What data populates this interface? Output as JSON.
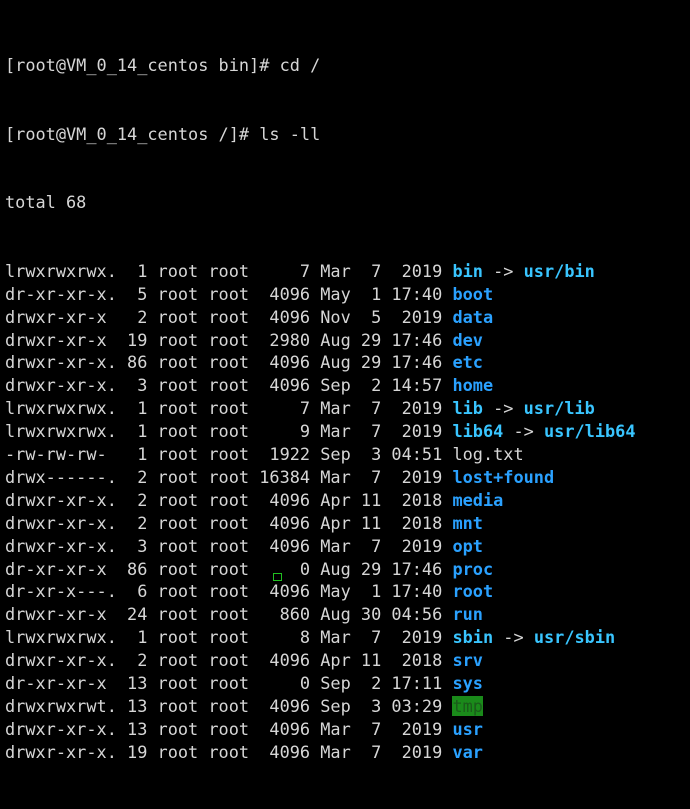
{
  "terminal": {
    "colors": {
      "background": "#000000",
      "text": "#d6d6d6",
      "directory": "#2aa1ff",
      "symlink": "#39c5ff",
      "sticky_dir_bg": "#1a8a1a",
      "cursor": "#20c020"
    },
    "prompts": [
      {
        "text": "[root@VM_0_14_centos bin]# cd /"
      },
      {
        "text": "[root@VM_0_14_centos /]# ls -ll"
      }
    ],
    "total": "total 68",
    "entries": [
      {
        "meta": "lrwxrwxrwx.  1 root root     7 Mar  7  2019 ",
        "name": "bin",
        "type": "link",
        "arrow": " -> ",
        "target": "usr/bin"
      },
      {
        "meta": "dr-xr-xr-x.  5 root root  4096 May  1 17:40 ",
        "name": "boot",
        "type": "dir"
      },
      {
        "meta": "drwxr-xr-x   2 root root  4096 Nov  5  2019 ",
        "name": "data",
        "type": "dir"
      },
      {
        "meta": "drwxr-xr-x  19 root root  2980 Aug 29 17:46 ",
        "name": "dev",
        "type": "dir"
      },
      {
        "meta": "drwxr-xr-x. 86 root root  4096 Aug 29 17:46 ",
        "name": "etc",
        "type": "dir"
      },
      {
        "meta": "drwxr-xr-x.  3 root root  4096 Sep  2 14:57 ",
        "name": "home",
        "type": "dir"
      },
      {
        "meta": "lrwxrwxrwx.  1 root root     7 Mar  7  2019 ",
        "name": "lib",
        "type": "link",
        "arrow": " -> ",
        "target": "usr/lib"
      },
      {
        "meta": "lrwxrwxrwx.  1 root root     9 Mar  7  2019 ",
        "name": "lib64",
        "type": "link",
        "arrow": " -> ",
        "target": "usr/lib64"
      },
      {
        "meta": "-rw-rw-rw-   1 root root  1922 Sep  3 04:51 ",
        "name": "log.txt",
        "type": "file"
      },
      {
        "meta": "drwx------.  2 root root 16384 Mar  7  2019 ",
        "name": "lost+found",
        "type": "dir"
      },
      {
        "meta": "drwxr-xr-x.  2 root root  4096 Apr 11  2018 ",
        "name": "media",
        "type": "dir"
      },
      {
        "meta": "drwxr-xr-x.  2 root root  4096 Apr 11  2018 ",
        "name": "mnt",
        "type": "dir"
      },
      {
        "meta": "drwxr-xr-x.  3 root root  4096 Mar  7  2019 ",
        "name": "opt",
        "type": "dir"
      },
      {
        "meta": "dr-xr-xr-x  86 root root     0 Aug 29 17:46 ",
        "name": "proc",
        "type": "dir"
      },
      {
        "meta": "dr-xr-x---.  6 root root  4096 May  1 17:40 ",
        "name": "root",
        "type": "dir"
      },
      {
        "meta": "drwxr-xr-x  24 root root   860 Aug 30 04:56 ",
        "name": "run",
        "type": "dir"
      },
      {
        "meta": "lrwxrwxrwx.  1 root root     8 Mar  7  2019 ",
        "name": "sbin",
        "type": "link",
        "arrow": " -> ",
        "target": "usr/sbin"
      },
      {
        "meta": "drwxr-xr-x.  2 root root  4096 Apr 11  2018 ",
        "name": "srv",
        "type": "dir"
      },
      {
        "meta": "dr-xr-xr-x  13 root root     0 Sep  2 17:11 ",
        "name": "sys",
        "type": "dir"
      },
      {
        "meta": "drwxrwxrwt. 13 root root  4096 Sep  3 03:29 ",
        "name": "tmp",
        "type": "sticky"
      },
      {
        "meta": "drwxr-xr-x. 13 root root  4096 Mar  7  2019 ",
        "name": "usr",
        "type": "dir"
      },
      {
        "meta": "drwxr-xr-x. 19 root root  4096 Mar  7  2019 ",
        "name": "var",
        "type": "dir"
      }
    ]
  }
}
